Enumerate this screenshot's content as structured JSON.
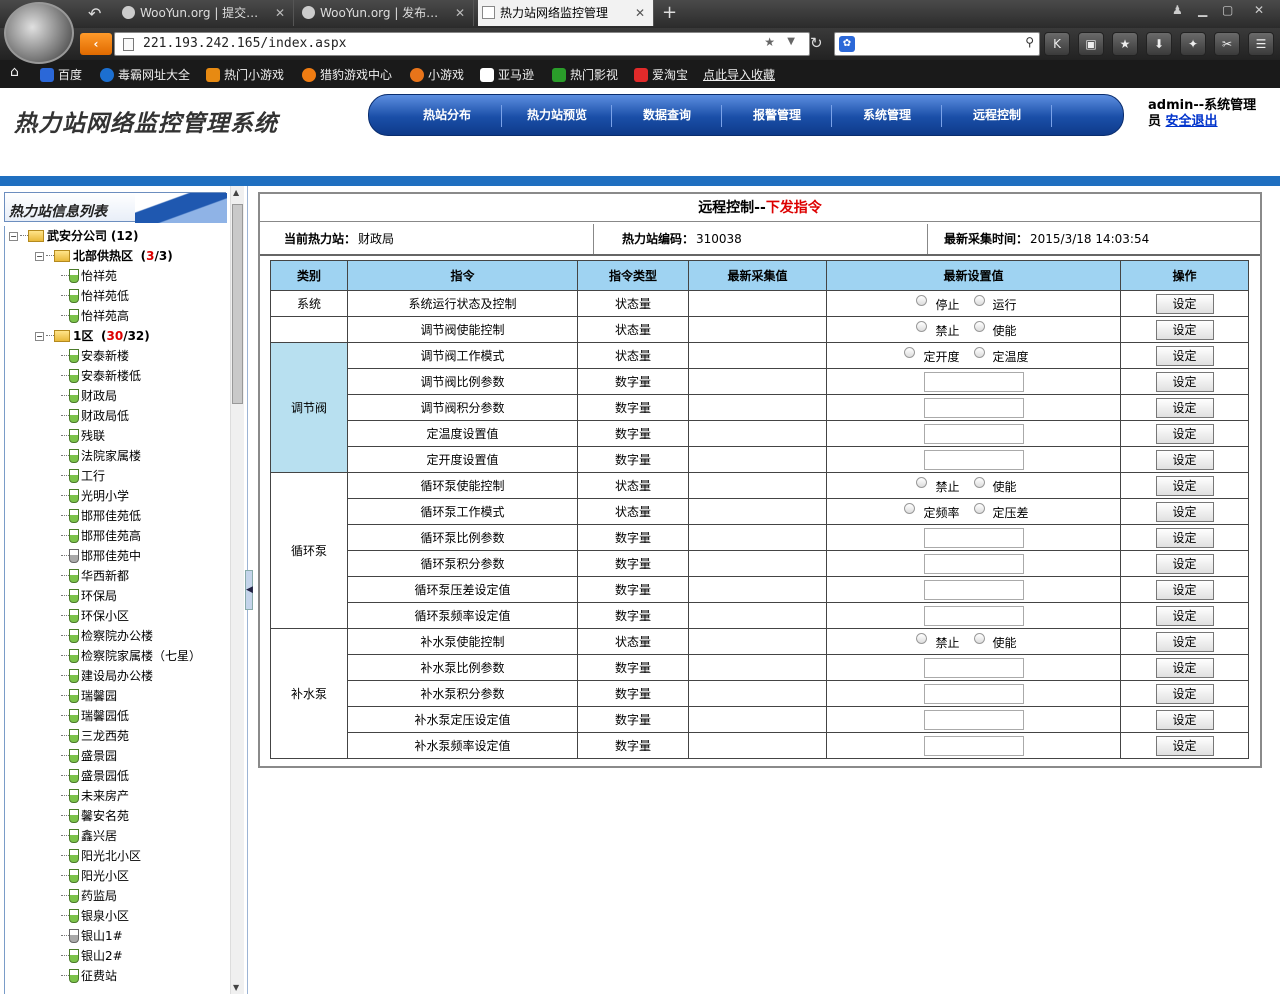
{
  "browser": {
    "tabs": [
      {
        "label": "WooYun.org | 提交…"
      },
      {
        "label": "WooYun.org | 发布…"
      },
      {
        "label": "热力站网络监控管理"
      }
    ],
    "url": "221.193.242.165/index.aspx",
    "bookmarks": [
      {
        "label": "百度",
        "color": "#2b68d8"
      },
      {
        "label": "毒霸网址大全",
        "color": "#1c6fd0"
      },
      {
        "label": "热门小游戏",
        "color": "#e78a12"
      },
      {
        "label": "猎豹游戏中心",
        "color": "#ef7c12"
      },
      {
        "label": "小游戏",
        "color": "#e8741a"
      },
      {
        "label": "亚马逊",
        "color": "#222222"
      },
      {
        "label": "热门影视",
        "color": "#2a9d2a"
      },
      {
        "label": "爱淘宝",
        "color": "#e12a2a"
      },
      {
        "label": "点此导入收藏",
        "color": ""
      }
    ]
  },
  "app": {
    "title": "热力站网络监控管理系统",
    "nav": [
      "热站分布",
      "热力站预览",
      "数据查询",
      "报警管理",
      "系统管理",
      "远程控制"
    ],
    "user_line1": "admin--系统管理",
    "user_line2": "员",
    "logout": "安全退出"
  },
  "sidebar": {
    "title": "热力站信息列表",
    "company": {
      "name": "武安分公司",
      "count": "(12)"
    },
    "district1": {
      "name": "北部供热区",
      "open": "(",
      "active": "3",
      "total": "/3)"
    },
    "district1_items": [
      "怡祥苑",
      "怡祥苑低",
      "怡祥苑高"
    ],
    "district2": {
      "name": "1区",
      "open": "(",
      "active": "30",
      "total": "/32)"
    },
    "district2_items": [
      {
        "name": "安泰新楼",
        "online": true
      },
      {
        "name": "安泰新楼低",
        "online": true
      },
      {
        "name": "财政局",
        "online": true
      },
      {
        "name": "财政局低",
        "online": true
      },
      {
        "name": "残联",
        "online": true
      },
      {
        "name": "法院家属楼",
        "online": true
      },
      {
        "name": "工行",
        "online": true
      },
      {
        "name": "光明小学",
        "online": true
      },
      {
        "name": "邯邢佳苑低",
        "online": true
      },
      {
        "name": "邯邢佳苑高",
        "online": true
      },
      {
        "name": "邯邢佳苑中",
        "online": false
      },
      {
        "name": "华西新都",
        "online": true
      },
      {
        "name": "环保局",
        "online": true
      },
      {
        "name": "环保小区",
        "online": true
      },
      {
        "name": "检察院办公楼",
        "online": true
      },
      {
        "name": "检察院家属楼（七星）",
        "online": true
      },
      {
        "name": "建设局办公楼",
        "online": true
      },
      {
        "name": "瑞馨园",
        "online": true
      },
      {
        "name": "瑞馨园低",
        "online": true
      },
      {
        "name": "三龙西苑",
        "online": true
      },
      {
        "name": "盛景园",
        "online": true
      },
      {
        "name": "盛景园低",
        "online": true
      },
      {
        "name": "未来房产",
        "online": true
      },
      {
        "name": "馨安名苑",
        "online": true
      },
      {
        "name": "鑫兴居",
        "online": true
      },
      {
        "name": "阳光北小区",
        "online": true
      },
      {
        "name": "阳光小区",
        "online": true
      },
      {
        "name": "药监局",
        "online": true
      },
      {
        "name": "银泉小区",
        "online": true
      },
      {
        "name": "银山1#",
        "online": false
      },
      {
        "name": "银山2#",
        "online": true
      },
      {
        "name": "征费站",
        "online": true
      }
    ]
  },
  "panel": {
    "title_prefix": "远程控制--",
    "title_suffix": "下发指令",
    "station_label": "当前热力站：",
    "station_value": "财政局",
    "code_label": "热力站编码：",
    "code_value": "310038",
    "time_label": "最新采集时间：",
    "time_value": "2015/3/18 14:03:54",
    "headers": [
      "类别",
      "指令",
      "指令类型",
      "最新采集值",
      "最新设置值",
      "操作"
    ],
    "button_label": "设定",
    "rows": [
      {
        "cat": "系统",
        "cmd": "系统运行状态及控制",
        "type": "状态量",
        "opts": [
          "停止",
          "运行"
        ]
      },
      {
        "cat": "",
        "cmd": "调节阀使能控制",
        "type": "状态量",
        "opts": [
          "禁止",
          "使能"
        ]
      },
      {
        "cat": "调节阀",
        "cmd": "调节阀工作模式",
        "type": "状态量",
        "opts": [
          "定开度",
          "定温度"
        ]
      },
      {
        "cat": "",
        "cmd": "调节阀比例参数",
        "type": "数字量",
        "opts": []
      },
      {
        "cat": "",
        "cmd": "调节阀积分参数",
        "type": "数字量",
        "opts": []
      },
      {
        "cat": "",
        "cmd": "定温度设置值",
        "type": "数字量",
        "opts": []
      },
      {
        "cat": "",
        "cmd": "定开度设置值",
        "type": "数字量",
        "opts": []
      },
      {
        "cat": "循环泵",
        "cmd": "循环泵使能控制",
        "type": "状态量",
        "opts": [
          "禁止",
          "使能"
        ]
      },
      {
        "cat": "",
        "cmd": "循环泵工作模式",
        "type": "状态量",
        "opts": [
          "定频率",
          "定压差"
        ]
      },
      {
        "cat": "",
        "cmd": "循环泵比例参数",
        "type": "数字量",
        "opts": []
      },
      {
        "cat": "",
        "cmd": "循环泵积分参数",
        "type": "数字量",
        "opts": []
      },
      {
        "cat": "",
        "cmd": "循环泵压差设定值",
        "type": "数字量",
        "opts": []
      },
      {
        "cat": "",
        "cmd": "循环泵频率设定值",
        "type": "数字量",
        "opts": []
      },
      {
        "cat": "补水泵",
        "cmd": "补水泵使能控制",
        "type": "状态量",
        "opts": [
          "禁止",
          "使能"
        ]
      },
      {
        "cat": "",
        "cmd": "补水泵比例参数",
        "type": "数字量",
        "opts": []
      },
      {
        "cat": "",
        "cmd": "补水泵积分参数",
        "type": "数字量",
        "opts": []
      },
      {
        "cat": "",
        "cmd": "补水泵定压设定值",
        "type": "数字量",
        "opts": []
      },
      {
        "cat": "",
        "cmd": "补水泵频率设定值",
        "type": "数字量",
        "opts": []
      }
    ]
  }
}
